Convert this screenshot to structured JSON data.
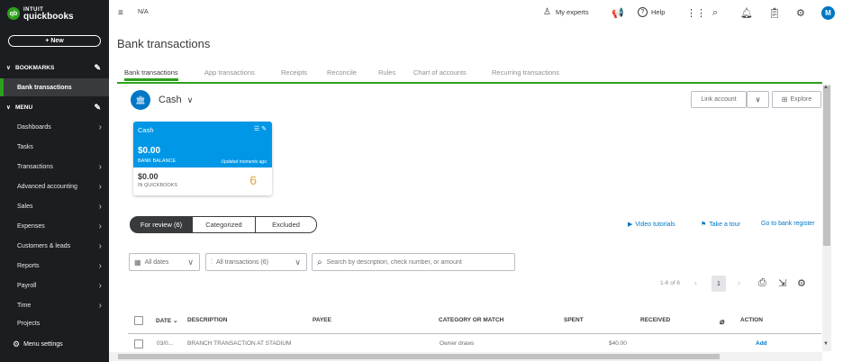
{
  "brand": {
    "line1": "INTUIT",
    "line2": "quickbooks",
    "mark": "qb",
    "color": "#2ca01c"
  },
  "sidebar": {
    "new_label": "+ New",
    "bookmarks_label": "BOOKMARKS",
    "bookmark_items": [
      {
        "label": "Bank transactions",
        "active": true
      }
    ],
    "menu_label": "MENU",
    "menu_items": [
      {
        "label": "Dashboards"
      },
      {
        "label": "Tasks"
      },
      {
        "label": "Transactions"
      },
      {
        "label": "Advanced accounting"
      },
      {
        "label": "Sales"
      },
      {
        "label": "Expenses"
      },
      {
        "label": "Customers & leads"
      },
      {
        "label": "Reports"
      },
      {
        "label": "Payroll"
      },
      {
        "label": "Time"
      },
      {
        "label": "Projects"
      }
    ],
    "menu_settings": "Menu settings"
  },
  "topbar": {
    "company": "N/A",
    "my_experts": "My experts",
    "help": "Help",
    "avatar_initial": "M"
  },
  "page": {
    "title": "Bank transactions"
  },
  "tabs": [
    "Bank transactions",
    "App transactions",
    "Receipts",
    "Reconcile",
    "Rules",
    "Chart of accounts",
    "Recurring transactions"
  ],
  "account": {
    "name": "Cash",
    "link_account": "Link account",
    "explore": "Explore"
  },
  "card": {
    "name": "Cash",
    "bank_balance": "$0.00",
    "bank_balance_label": "BANK BALANCE",
    "updated": "Updated moments ago",
    "qb_balance": "$0.00",
    "qb_label": "IN QUICKBOOKS",
    "count": "6"
  },
  "segments": [
    "For review (6)",
    "Categorized",
    "Excluded"
  ],
  "links": {
    "video": "Video tutorials",
    "tour": "Take a tour",
    "register": "Go to bank register"
  },
  "filters": {
    "dates": "All dates",
    "transactions": "All transactions (6)",
    "search_placeholder": "Search by description, check number, or amount"
  },
  "pager": {
    "range": "1-6 of 6",
    "page": "1"
  },
  "table": {
    "headers": {
      "date": "DATE",
      "description": "DESCRIPTION",
      "payee": "PAYEE",
      "category": "CATEGORY OR MATCH",
      "spent": "SPENT",
      "received": "RECEIVED",
      "action": "ACTION"
    },
    "rows": [
      {
        "date": "03/0...",
        "description": "BRANCH TRANSACTION AT STADIUM",
        "payee": "",
        "category": "Owner draws",
        "spent": "$40.00",
        "received": "",
        "action": "Add"
      }
    ]
  },
  "colors": {
    "accent": "#2ca01c",
    "blue": "#0077c5",
    "card_blue": "#0097e6",
    "sidebar": "#1c1d20"
  }
}
